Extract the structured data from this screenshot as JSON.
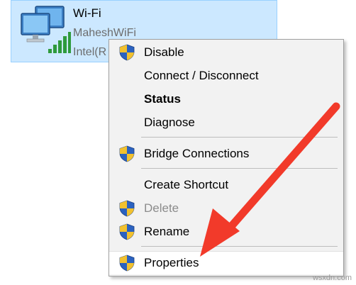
{
  "adapter": {
    "name": "Wi-Fi",
    "ssid": "MaheshWiFi",
    "device": "Intel(R"
  },
  "menu": {
    "items": [
      {
        "label": "Disable",
        "icon": "uac-shield-icon"
      },
      {
        "label": "Connect / Disconnect"
      },
      {
        "label": "Status"
      },
      {
        "label": "Diagnose"
      },
      {
        "label": "Bridge Connections",
        "icon": "uac-shield-icon"
      },
      {
        "label": "Create Shortcut"
      },
      {
        "label": "Delete",
        "icon": "uac-shield-icon"
      },
      {
        "label": "Rename",
        "icon": "uac-shield-icon"
      },
      {
        "label": "Properties",
        "icon": "uac-shield-icon"
      }
    ]
  },
  "annotation": {
    "arrow_color": "#f23a2a"
  },
  "watermark": "wsxdn.com"
}
